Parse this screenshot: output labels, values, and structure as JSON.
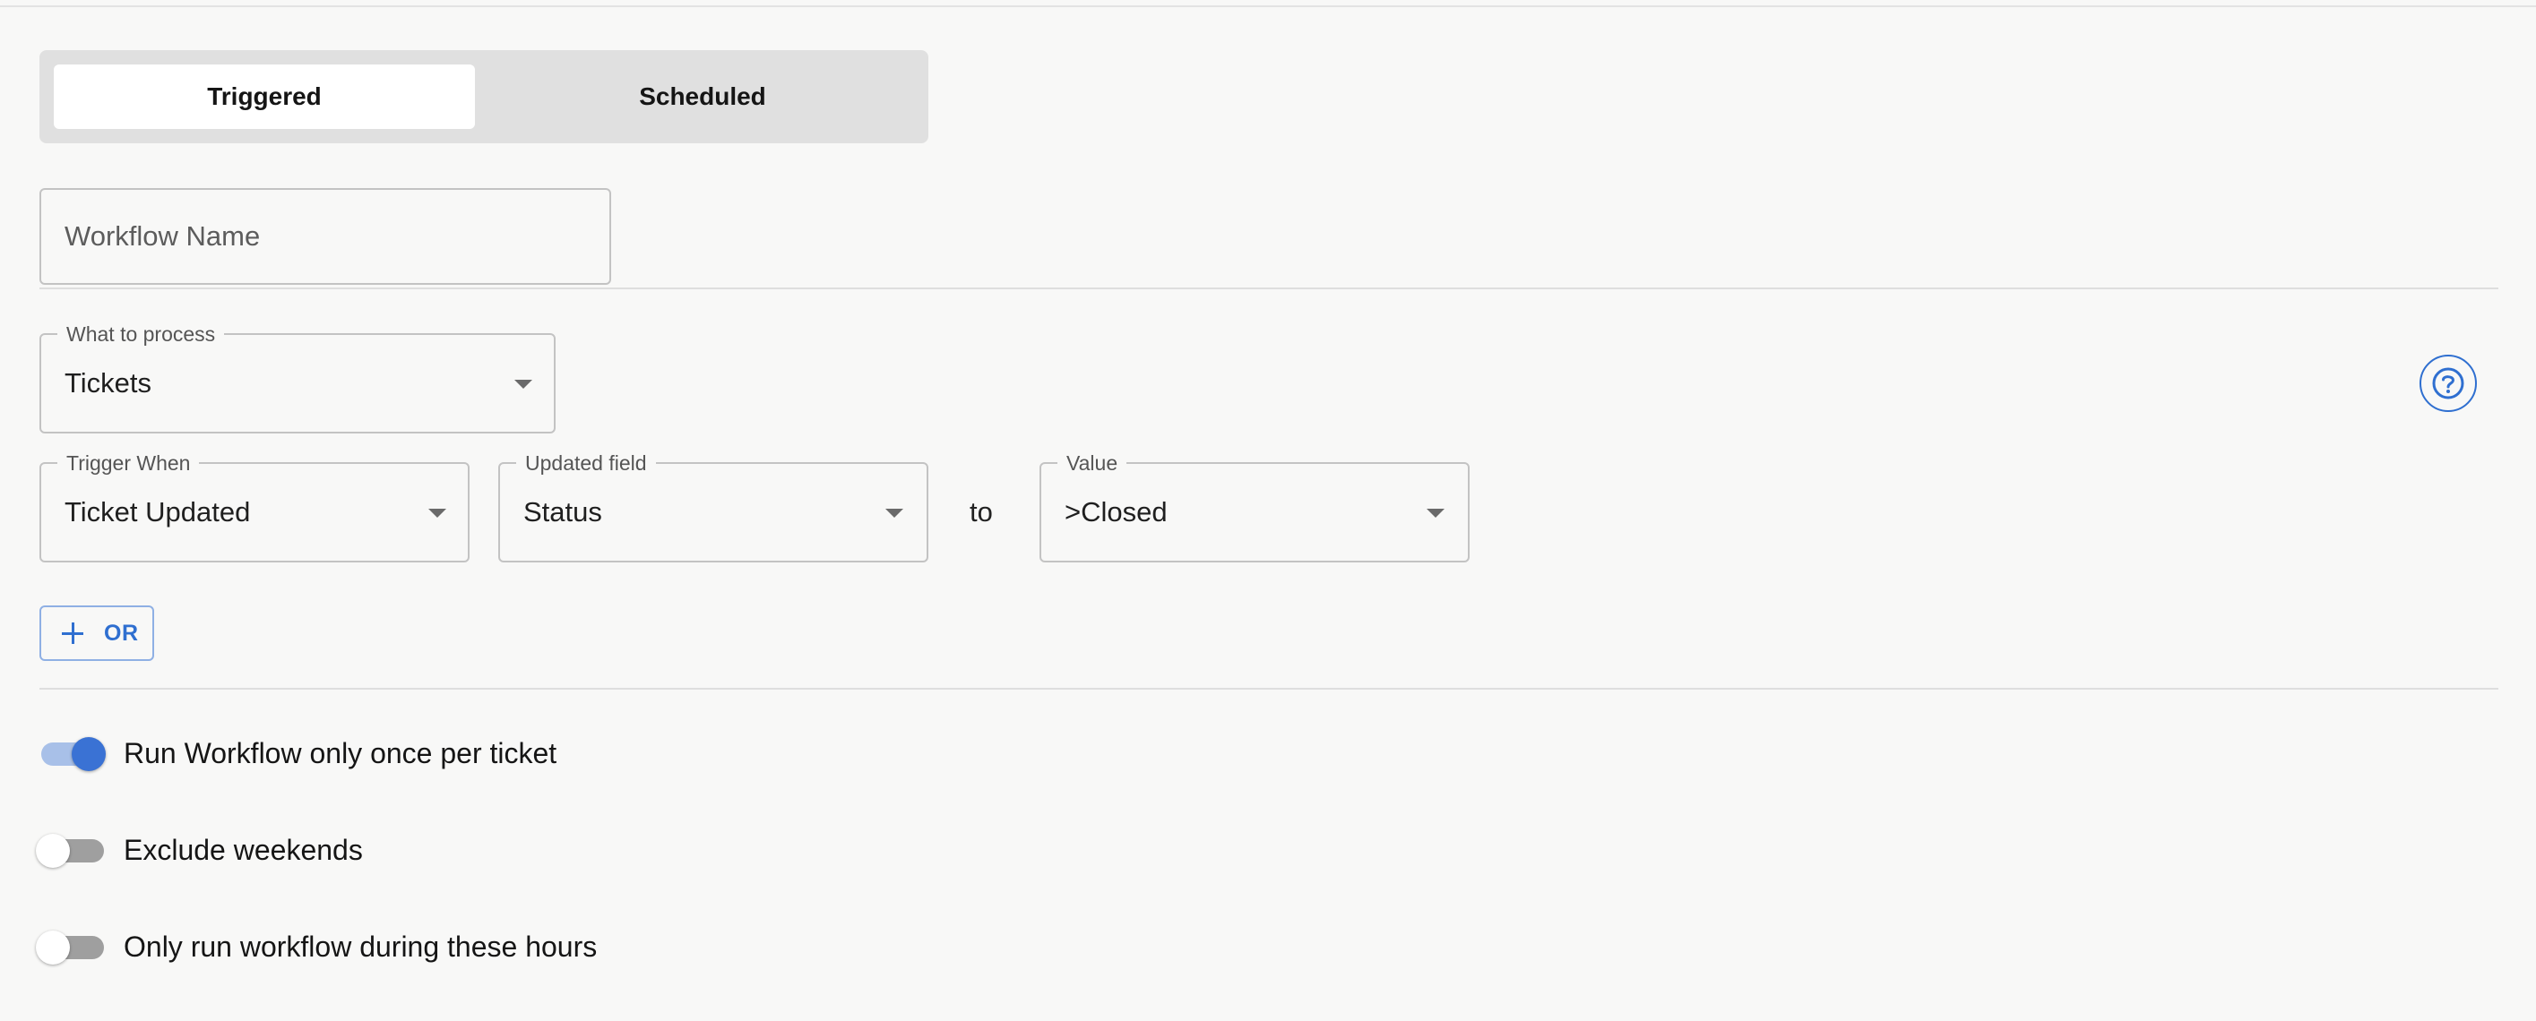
{
  "mode_toggle": {
    "options": [
      "Triggered",
      "Scheduled"
    ],
    "selected": "Triggered"
  },
  "workflow_name": {
    "value": "",
    "placeholder": "Workflow Name"
  },
  "process": {
    "label": "What to process",
    "value": "Tickets"
  },
  "trigger": {
    "label": "Trigger When",
    "value": "Ticket Updated"
  },
  "updated_field": {
    "label": "Updated field",
    "value": "Status"
  },
  "connector_text": "to",
  "value_field": {
    "label": "Value",
    "value": ">Closed"
  },
  "or_button": {
    "label": "OR",
    "icon": "plus-icon"
  },
  "help": {
    "icon": "question-circle-icon"
  },
  "options": [
    {
      "label": "Run Workflow only once per ticket",
      "enabled": true
    },
    {
      "label": "Exclude weekends",
      "enabled": false
    },
    {
      "label": "Only run workflow during these hours",
      "enabled": false
    }
  ],
  "colors": {
    "accent": "#3a72d4",
    "background": "#f8f8f7",
    "toggle_background": "#e0e0e0"
  }
}
